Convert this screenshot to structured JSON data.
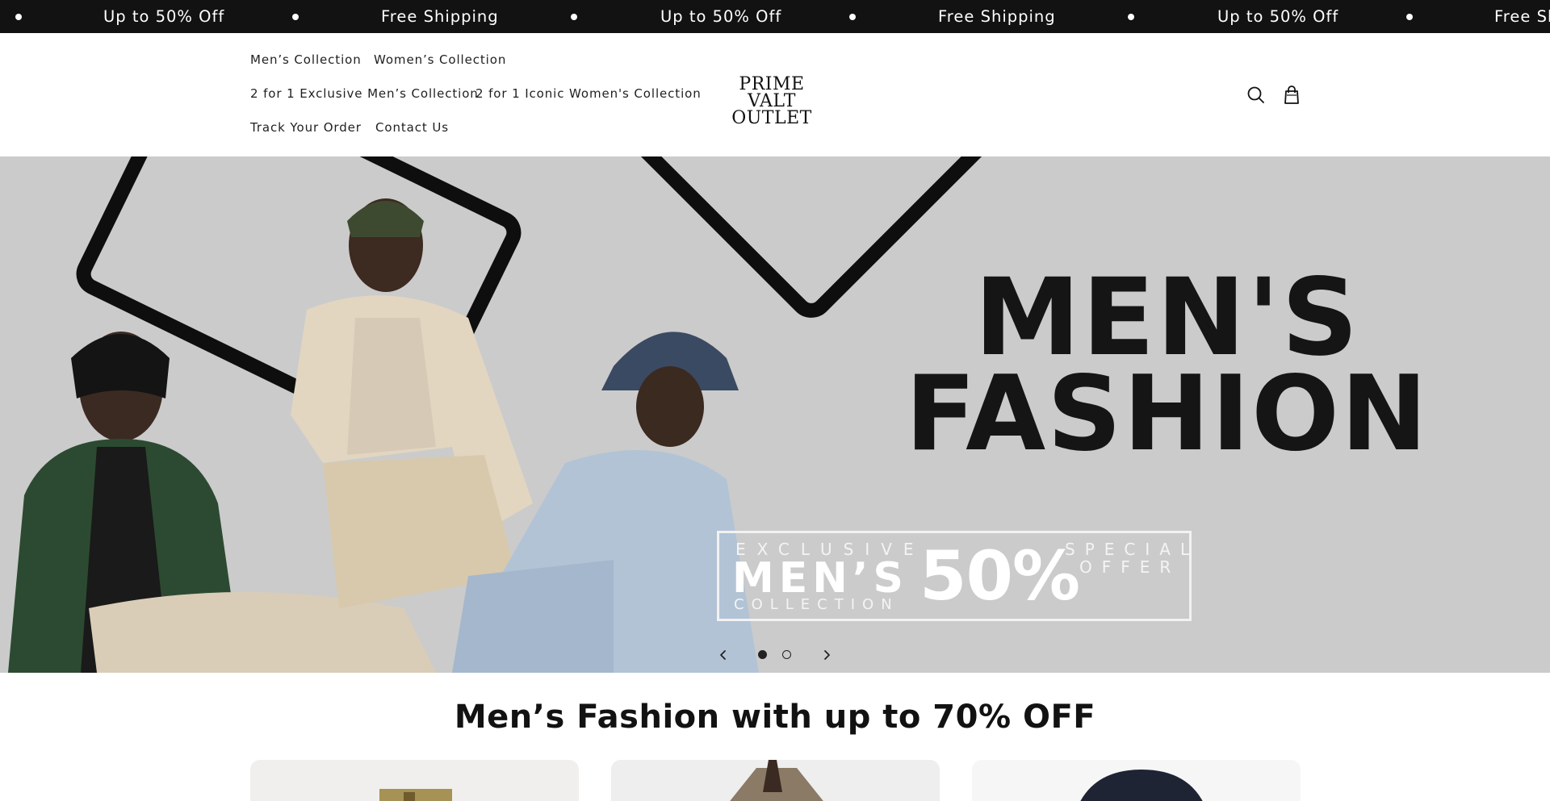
{
  "announcement": {
    "items": [
      "Up to 50% Off",
      "Free Shipping",
      "Up to 50% Off",
      "Free Shipping",
      "Up to 50% Off",
      "Free Sh"
    ]
  },
  "header": {
    "nav": {
      "mens": "Men’s Collection",
      "womens": "Women’s Collection",
      "two_for_one_mens": "2 for 1 Exclusive Men’s Collection",
      "two_for_one_womens": "2 for 1 Iconic Women's Collection",
      "track": "Track Your Order",
      "contact": "Contact Us"
    },
    "logo_line1": "PRIME VALT",
    "logo_line2": "OUTLET",
    "icons": [
      "search-icon",
      "cart-icon"
    ]
  },
  "hero": {
    "title_line1": "MEN'S",
    "title_line2": "FASHION",
    "offer": {
      "exclusive": "EXCLUSIVE",
      "mens": "MEN’S",
      "collection": "COLLECTION",
      "percent": "50%",
      "special": "SPECIAL",
      "offer": "OFFER"
    },
    "slides_total": 2,
    "active_slide": 1
  },
  "section": {
    "title": "Men’s Fashion with up to 70% OFF"
  },
  "colors": {
    "announce_bg": "#121212",
    "hero_bg": "#cbcbcb",
    "text": "#121212"
  }
}
